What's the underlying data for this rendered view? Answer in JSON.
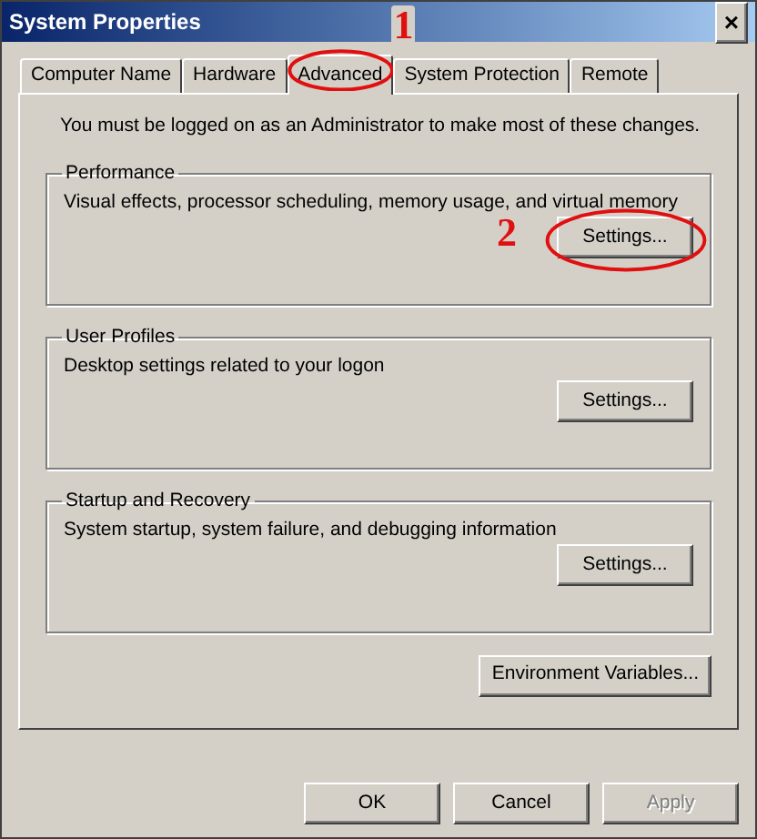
{
  "window": {
    "title": "System Properties",
    "close": "×"
  },
  "tabs": [
    {
      "label": "Computer Name",
      "selected": false
    },
    {
      "label": "Hardware",
      "selected": false
    },
    {
      "label": "Advanced",
      "selected": true,
      "annotation": "1"
    },
    {
      "label": "System Protection",
      "selected": false
    },
    {
      "label": "Remote",
      "selected": false
    }
  ],
  "notice": "You must be logged on as an Administrator to make most of these changes.",
  "groups": [
    {
      "title": "Performance",
      "description": "Visual effects, processor scheduling, memory usage, and virtual memory",
      "button": "Settings...",
      "annotation": "2"
    },
    {
      "title": "User Profiles",
      "description": "Desktop settings related to your logon",
      "button": "Settings..."
    },
    {
      "title": "Startup and Recovery",
      "description": "System startup, system failure, and debugging information",
      "button": "Settings..."
    }
  ],
  "environment_button": "Environment Variables...",
  "buttons": [
    {
      "label": "OK",
      "disabled": false
    },
    {
      "label": "Cancel",
      "disabled": false
    },
    {
      "label": "Apply",
      "disabled": true
    }
  ]
}
